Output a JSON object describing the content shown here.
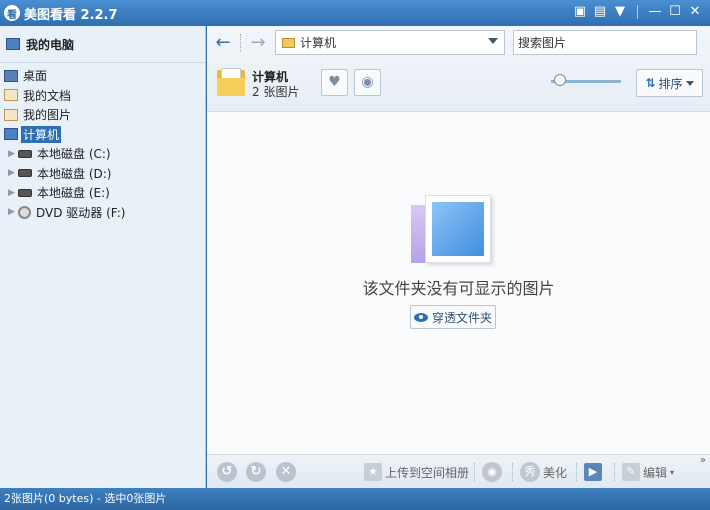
{
  "window": {
    "app_logo": "看",
    "title": "美图看看 2.2.7"
  },
  "titlebar": {
    "controls": [
      "chat-icon",
      "menu-icon",
      "skin-icon",
      "minimize-icon",
      "maximize-icon",
      "close-icon"
    ]
  },
  "sidebar": {
    "header": "我的电脑",
    "tree": [
      {
        "label": "桌面",
        "icon": "desktop-icon"
      },
      {
        "label": "我的文档",
        "icon": "documents-icon"
      },
      {
        "label": "我的图片",
        "icon": "pictures-icon"
      },
      {
        "label": "计算机",
        "icon": "computer-icon",
        "selected": true
      },
      {
        "label": "本地磁盘 (C:)",
        "icon": "hard-drive-icon"
      },
      {
        "label": "本地磁盘 (D:)",
        "icon": "hard-drive-icon"
      },
      {
        "label": "本地磁盘 (E:)",
        "icon": "hard-drive-icon"
      },
      {
        "label": "DVD 驱动器 (F:)",
        "icon": "dvd-drive-icon"
      }
    ]
  },
  "toolbar": {
    "address": "计算机",
    "search_value": "搜索图片",
    "folder_name": "计算机",
    "folder_count": "2 张图片",
    "sort_label": "排序"
  },
  "content": {
    "empty_message": "该文件夹没有可显示的图片",
    "through_folder_label": "穿透文件夹"
  },
  "bottombar": {
    "upload_label": "上传到空间相册",
    "beautify_label": "美化",
    "edit_label": "编辑"
  },
  "statusbar": {
    "text": "2张图片(0 bytes) - 选中0张图片"
  },
  "colors": {
    "accent": "#2f6fb0",
    "titlebar": "#3c7fc0"
  }
}
